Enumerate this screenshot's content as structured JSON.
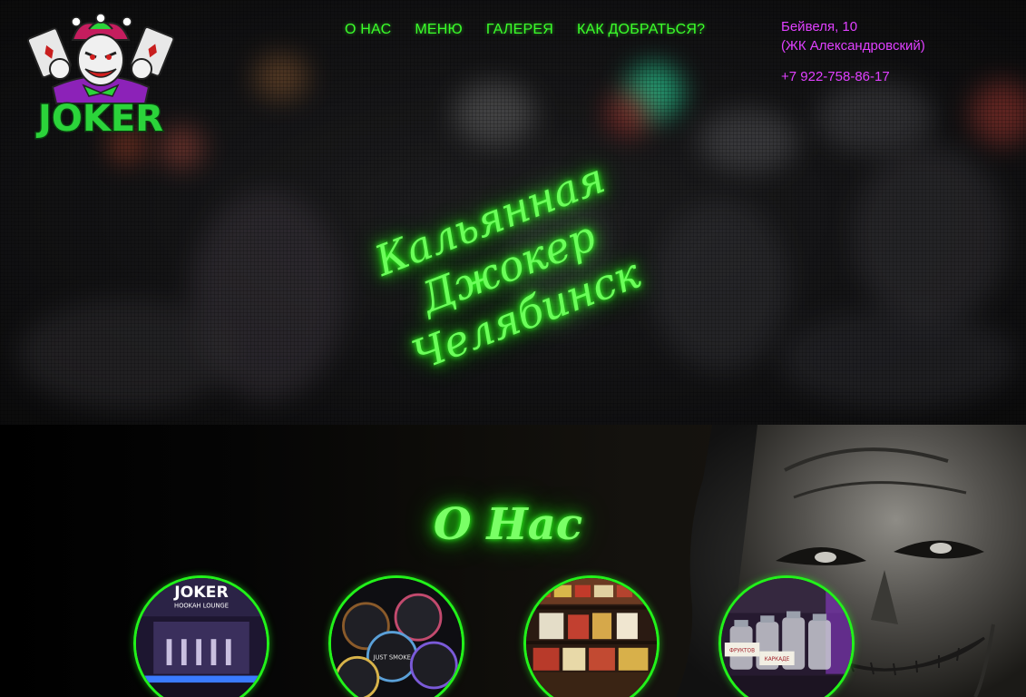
{
  "logo": {
    "text": "JOKER"
  },
  "nav": {
    "items": [
      {
        "label": "О НАС"
      },
      {
        "label": "МЕНЮ"
      },
      {
        "label": "ГАЛЕРЕЯ"
      },
      {
        "label": "КАК ДОБРАТЬСЯ?"
      }
    ]
  },
  "contacts": {
    "address_line1": "Бейвеля, 10",
    "address_line2": "(ЖК Александровский)",
    "phone": "+7 922-758-86-17"
  },
  "hero": {
    "line1": "Кальянная Джокер",
    "line2": "Челябинск"
  },
  "about": {
    "title": "О Нас",
    "photo1_sign_title": "JOKER",
    "photo1_sign_sub": "HOOKAH LOUNGE",
    "photo2_tin_text": "JUST SMOKE",
    "photo4_label1": "ФРУКТОВ",
    "photo4_label2": "КАРКАДЕ"
  },
  "colors": {
    "neon_green": "#3bff2a",
    "contact_magenta": "#e040ff"
  }
}
